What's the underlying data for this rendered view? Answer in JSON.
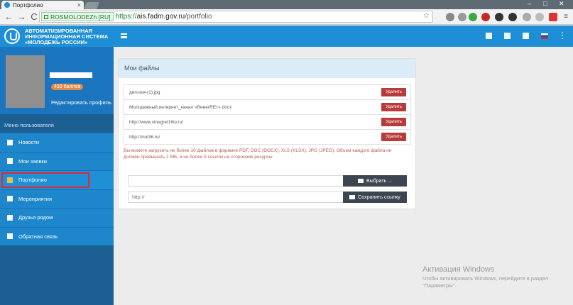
{
  "browser": {
    "tab_title": "Портфолио",
    "close_glyph": "×",
    "secure_label": "ROSMOLODEZh [RU]",
    "url_prefix": "https://",
    "url_host": "ais.fadm.gov.ru",
    "url_path": "/portfolio",
    "back_glyph": "←",
    "forward_glyph": "→",
    "reload_glyph": "C"
  },
  "header": {
    "line1": "АВТОМАТИЗИРОВАННАЯ",
    "line2": "ИНФОРМАЦИОННАЯ СИСТЕМА",
    "line3": "«МОЛОДЕЖЬ РОССИИ»"
  },
  "profile": {
    "points": "450 баллов",
    "edit": "Редактировать профиль"
  },
  "sidebar": {
    "menu_title": "Меню пользователя",
    "items": [
      {
        "label": "Новости"
      },
      {
        "label": "Мои заявки"
      },
      {
        "label": "Портфолио"
      },
      {
        "label": "Мероприятия"
      },
      {
        "label": "Друзья рядом"
      },
      {
        "label": "Обратная связь"
      }
    ]
  },
  "panel": {
    "title": "Мои файлы",
    "delete_label": "Удалить",
    "files": [
      {
        "name": "диплом-(1).jpg"
      },
      {
        "name": "Молодежный интернет_канал «ВинегREт».docx"
      },
      {
        "name": "http://www.vinegret16tv.ru/"
      },
      {
        "name": "http://mol36.ru/"
      }
    ],
    "note": "Вы можете загрузить не более 10 файлов в формате PDF, DOC (DOCX), XLS (XLSX), JPG (JPEG). Объем каждого файла не должен превышать 1 МБ, и не более 5 ссылок на сторонние ресурсы.",
    "choose_label": "Выбрать ...",
    "link_placeholder": "http://",
    "save_link_label": "Сохранить ссылку"
  },
  "watermark": {
    "title": "Активация Windows",
    "text": "Чтобы активировать Windows, перейдите в раздел \"Параметры\"."
  }
}
